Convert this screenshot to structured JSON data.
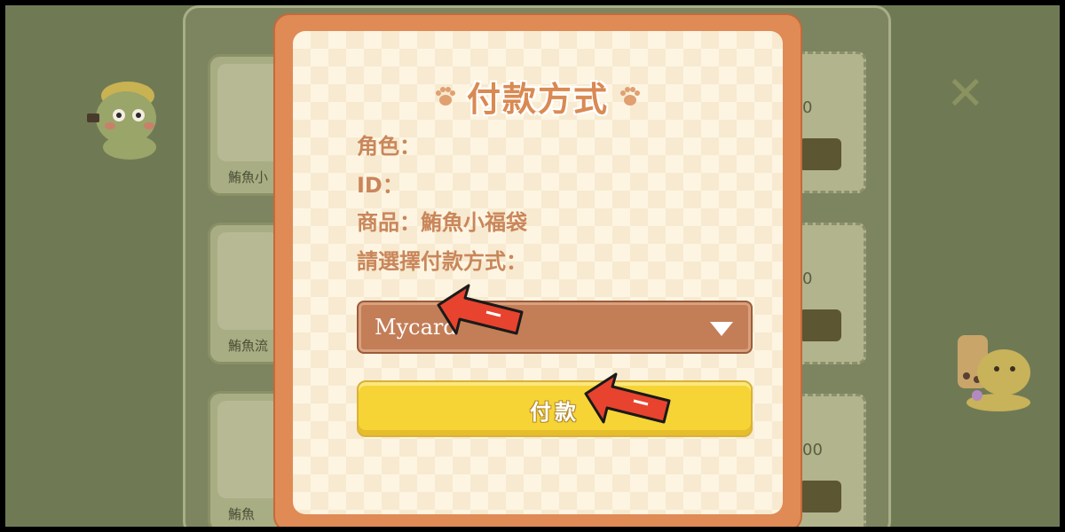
{
  "background": {
    "items": [
      {
        "caption": "鮪魚小"
      },
      {
        "caption": "鮪魚流"
      },
      {
        "caption": "鮪魚"
      }
    ],
    "prices": [
      "0",
      "0",
      "00"
    ]
  },
  "modal": {
    "title": "付款方式",
    "info": {
      "character_label": "角色：",
      "id_label": "ID：",
      "product_label": "商品：鮪魚小福袋",
      "prompt_label": "請選擇付款方式："
    },
    "payment_select": {
      "selected": "Mycard"
    },
    "pay_button_label": "付款"
  },
  "colors": {
    "modal_frame": "#e08a55",
    "title": "#d98a52",
    "text": "#c9865a",
    "select_bg": "#c37e57",
    "pay_button": "#f6d435",
    "annotation_arrow": "#e8432e"
  },
  "icons": [
    "paw-icon",
    "dropdown-triangle-icon",
    "close-x-icon",
    "red-arrow-annotation"
  ]
}
